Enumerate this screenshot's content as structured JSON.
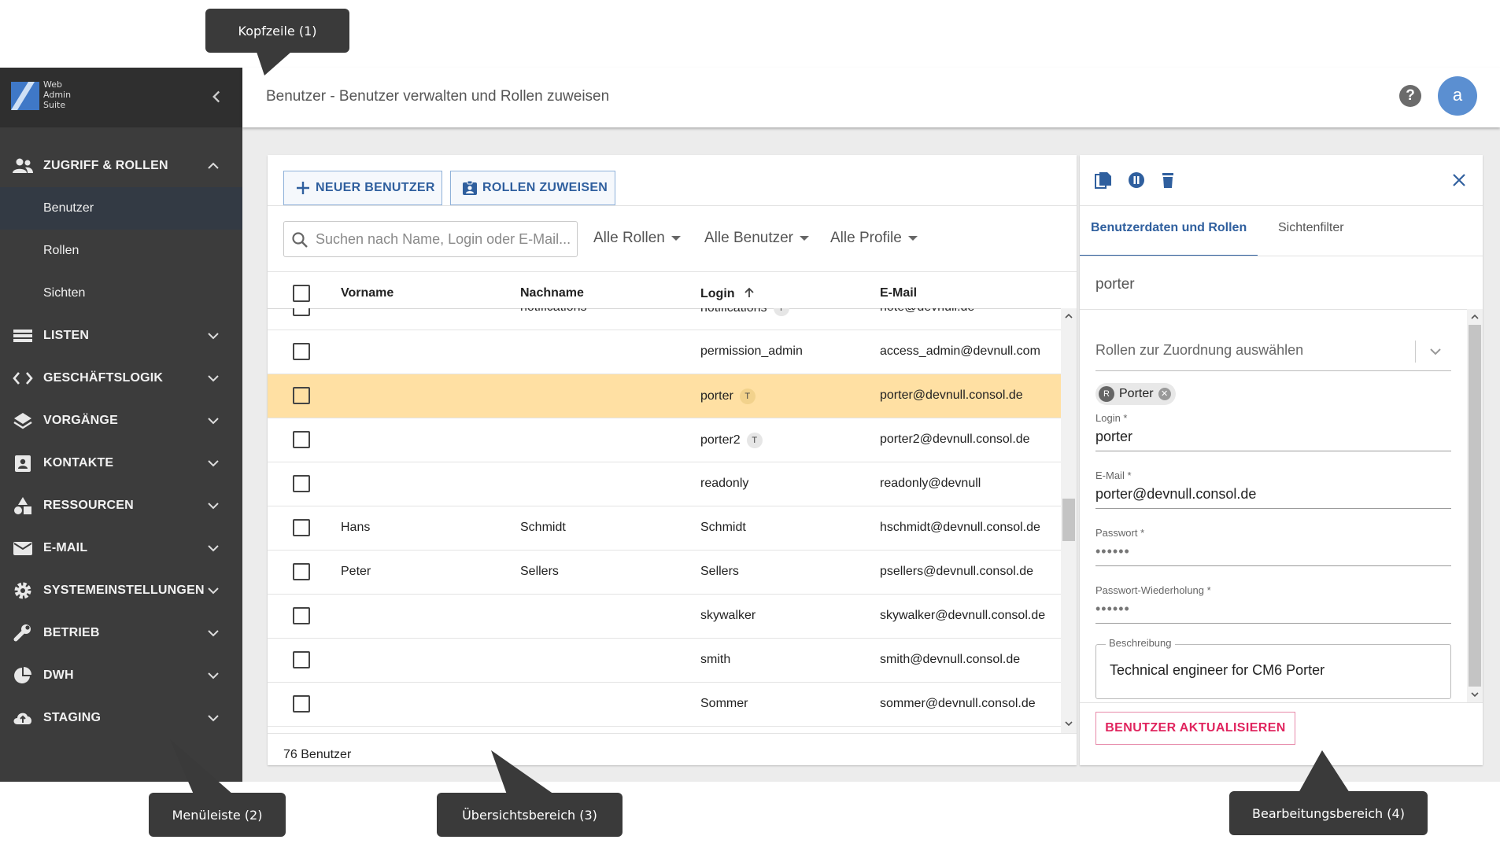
{
  "callouts": {
    "header": "Kopfzeile (1)",
    "menu": "Menüleiste (2)",
    "overview": "Übersichtsbereich (3)",
    "edit": "Bearbeitungsbereich (4)"
  },
  "logo": {
    "line1": "Web",
    "line2": "Admin",
    "line3": "Suite"
  },
  "header": {
    "title": "Benutzer - Benutzer verwalten und Rollen zuweisen",
    "help": "?",
    "avatar": "a"
  },
  "sidebar": {
    "group_open": {
      "label": "ZUGRIFF & ROLLEN",
      "icon": "people-icon"
    },
    "sub_items": [
      {
        "label": "Benutzer"
      },
      {
        "label": "Rollen"
      },
      {
        "label": "Sichten"
      }
    ],
    "items": [
      {
        "label": "LISTEN",
        "icon": "list-icon"
      },
      {
        "label": "GESCHÄFTSLOGIK",
        "icon": "code-icon"
      },
      {
        "label": "VORGÄNGE",
        "icon": "layers-icon"
      },
      {
        "label": "KONTAKTE",
        "icon": "contact-icon"
      },
      {
        "label": "RESSOURCEN",
        "icon": "shapes-icon"
      },
      {
        "label": "E-MAIL",
        "icon": "mail-icon"
      },
      {
        "label": "SYSTEMEINSTELLUNGEN",
        "icon": "gear-icon"
      },
      {
        "label": "BETRIEB",
        "icon": "wrench-icon"
      },
      {
        "label": "DWH",
        "icon": "pie-icon"
      },
      {
        "label": "STAGING",
        "icon": "cloud-upload-icon"
      }
    ]
  },
  "overview": {
    "new_user_label": "NEUER BENUTZER",
    "assign_roles_label": "ROLLEN ZUWEISEN",
    "search_placeholder": "Suchen nach Name, Login oder E-Mail...",
    "filters": [
      "Alle Rollen",
      "Alle Benutzer",
      "Alle Profile"
    ],
    "columns": [
      "Vorname",
      "Nachname",
      "Login",
      "E-Mail"
    ],
    "rows": [
      {
        "first": "",
        "last": "notifications",
        "login": "notifications",
        "badge": "T",
        "email": "note@devnull.de"
      },
      {
        "first": "",
        "last": "",
        "login": "permission_admin",
        "badge": "",
        "email": "access_admin@devnull.com"
      },
      {
        "first": "",
        "last": "",
        "login": "porter",
        "badge": "T",
        "email": "porter@devnull.consol.de"
      },
      {
        "first": "",
        "last": "",
        "login": "porter2",
        "badge": "T",
        "email": "porter2@devnull.consol.de"
      },
      {
        "first": "",
        "last": "",
        "login": "readonly",
        "badge": "",
        "email": "readonly@devnull"
      },
      {
        "first": "Hans",
        "last": "Schmidt",
        "login": "Schmidt",
        "badge": "",
        "email": "hschmidt@devnull.consol.de"
      },
      {
        "first": "Peter",
        "last": "Sellers",
        "login": "Sellers",
        "badge": "",
        "email": "psellers@devnull.consol.de"
      },
      {
        "first": "",
        "last": "",
        "login": "skywalker",
        "badge": "",
        "email": "skywalker@devnull.consol.de"
      },
      {
        "first": "",
        "last": "",
        "login": "smith",
        "badge": "",
        "email": "smith@devnull.consol.de"
      },
      {
        "first": "",
        "last": "",
        "login": "Sommer",
        "badge": "",
        "email": "sommer@devnull.consol.de"
      }
    ],
    "selected_row_color": "#ffe0a3",
    "count": "76 Benutzer"
  },
  "edit": {
    "tabs": [
      "Benutzerdaten und Rollen",
      "Sichtenfilter"
    ],
    "user": "porter",
    "roles_placeholder": "Rollen zur Zuordnung auswählen",
    "role_chip": {
      "initial": "R",
      "label": "Porter"
    },
    "login_label": "Login *",
    "login_value": "porter",
    "email_label": "E-Mail *",
    "email_value": "porter@devnull.consol.de",
    "password_label": "Passwort *",
    "password_value": "••••••",
    "password_repeat_label": "Passwort-Wiederholung *",
    "password_repeat_value": "••••••",
    "description_label": "Beschreibung",
    "description_value": "Technical engineer for CM6 Porter",
    "update_label": "BENUTZER AKTUALISIEREN"
  }
}
